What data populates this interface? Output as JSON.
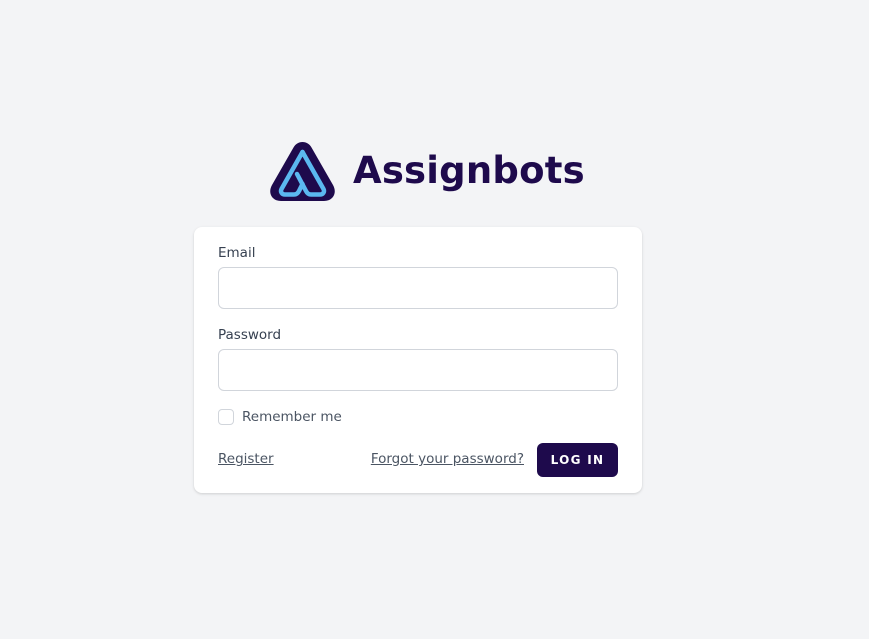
{
  "brand": {
    "name": "Assignbots",
    "logo_icon": "assignbots-a-logo-icon",
    "primary_color": "#1e0a4c",
    "accent_color": "#5bb8f0"
  },
  "form": {
    "email": {
      "label": "Email",
      "value": "",
      "placeholder": ""
    },
    "password": {
      "label": "Password",
      "value": "",
      "placeholder": ""
    },
    "remember": {
      "label": "Remember me",
      "checked": false
    },
    "register_link": "Register",
    "forgot_link": "Forgot your password?",
    "submit_label": "LOG IN"
  },
  "colors": {
    "background": "#f3f4f6",
    "card": "#ffffff",
    "input_border": "#d1d5db",
    "label_text": "#374151",
    "link_text": "#4b5563"
  }
}
